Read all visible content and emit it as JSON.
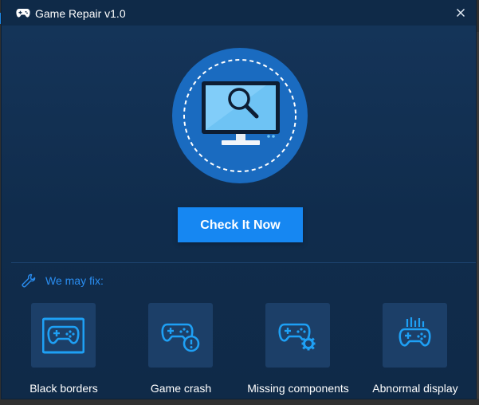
{
  "window": {
    "title": "Game Repair v1.0",
    "accent_color": "#1687f2",
    "background_color": "#15355a"
  },
  "icons": {
    "title": "gamepad-icon",
    "close": "close-icon",
    "hero": "monitor-magnifier-icon",
    "fix_header": "wrench-icon"
  },
  "main": {
    "check_button_label": "Check It Now"
  },
  "fix_section": {
    "header": "We may fix:",
    "items": [
      {
        "label": "Black borders",
        "icon": "gamepad-borders-icon"
      },
      {
        "label": "Game crash",
        "icon": "gamepad-alert-icon"
      },
      {
        "label": "Missing components",
        "icon": "gamepad-gear-icon"
      },
      {
        "label": "Abnormal display",
        "icon": "gamepad-display-icon"
      }
    ]
  }
}
